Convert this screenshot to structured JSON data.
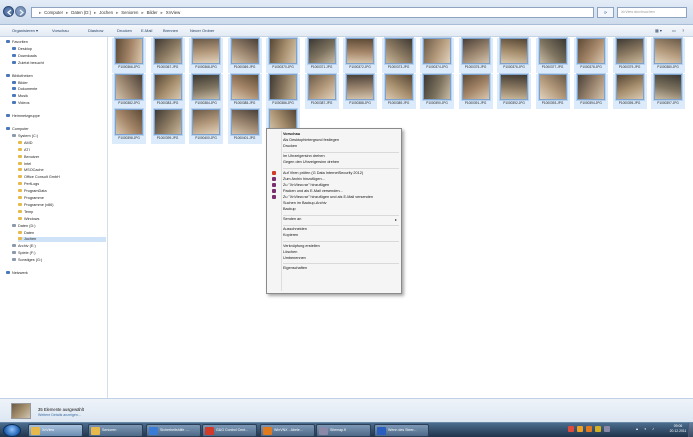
{
  "address_bar": {
    "breadcrumb": [
      "Computer",
      "Daten (D:)",
      "Jochen",
      "Senioren",
      "Bilder",
      "XnView"
    ],
    "search_placeholder": "XnView durchsuchen",
    "refresh_icon": "refresh-icon"
  },
  "toolbar": {
    "organize": "Organisieren ▾",
    "preview": "Vorschau",
    "slideshow": "Diashow",
    "print": "Drucken",
    "email": "E-Mail",
    "burn": "Brennen",
    "new_folder": "Neuer Ordner"
  },
  "nav": {
    "items": [
      {
        "label": "Favoriten",
        "indent": 0,
        "icon": "star-icon"
      },
      {
        "label": "Desktop",
        "indent": 1,
        "icon": "desktop-icon"
      },
      {
        "label": "Downloads",
        "indent": 1,
        "icon": "downloads-icon"
      },
      {
        "label": "Zuletzt besucht",
        "indent": 1,
        "icon": "recent-icon"
      },
      {
        "label": "Bibliotheken",
        "indent": 0,
        "icon": "libraries-icon",
        "gap": true
      },
      {
        "label": "Bilder",
        "indent": 1,
        "icon": "pictures-icon"
      },
      {
        "label": "Dokumente",
        "indent": 1,
        "icon": "documents-icon"
      },
      {
        "label": "Musik",
        "indent": 1,
        "icon": "music-icon"
      },
      {
        "label": "Videos",
        "indent": 1,
        "icon": "videos-icon"
      },
      {
        "label": "Heimnetzgruppe",
        "indent": 0,
        "icon": "homegroup-icon",
        "gap": true
      },
      {
        "label": "Computer",
        "indent": 0,
        "icon": "computer-icon",
        "gap": true
      },
      {
        "label": "System (C:)",
        "indent": 1,
        "icon": "drive-icon"
      },
      {
        "label": "AMD",
        "indent": 2,
        "icon": "folder-icon"
      },
      {
        "label": "ATI",
        "indent": 2,
        "icon": "folder-icon"
      },
      {
        "label": "Benutzer",
        "indent": 2,
        "icon": "folder-icon"
      },
      {
        "label": "Intel",
        "indent": 2,
        "icon": "folder-icon"
      },
      {
        "label": "MSOCache",
        "indent": 2,
        "icon": "folder-icon"
      },
      {
        "label": "Office Consult GmbH",
        "indent": 2,
        "icon": "folder-icon"
      },
      {
        "label": "PerfLogs",
        "indent": 2,
        "icon": "folder-icon"
      },
      {
        "label": "ProgramData",
        "indent": 2,
        "icon": "folder-icon"
      },
      {
        "label": "Programme",
        "indent": 2,
        "icon": "folder-icon"
      },
      {
        "label": "Programme (x86)",
        "indent": 2,
        "icon": "folder-icon"
      },
      {
        "label": "Temp",
        "indent": 2,
        "icon": "folder-icon"
      },
      {
        "label": "Windows",
        "indent": 2,
        "icon": "folder-icon"
      },
      {
        "label": "Daten (D:)",
        "indent": 1,
        "icon": "drive-icon"
      },
      {
        "label": "Daten",
        "indent": 2,
        "icon": "folder-icon"
      },
      {
        "label": "Jochen",
        "indent": 2,
        "icon": "folder-icon",
        "selected": true
      },
      {
        "label": "Archiv (E:)",
        "indent": 1,
        "icon": "drive-icon"
      },
      {
        "label": "Spiele (F:)",
        "indent": 1,
        "icon": "drive-icon"
      },
      {
        "label": "Sonstiges (G:)",
        "indent": 1,
        "icon": "drive-icon"
      },
      {
        "label": "Netzwerk",
        "indent": 0,
        "icon": "network-icon",
        "gap": true
      }
    ]
  },
  "thumbnails": [
    {
      "name": "P1000366.JPG"
    },
    {
      "name": "P1000367.JPG"
    },
    {
      "name": "P1000368.JPG"
    },
    {
      "name": "P1000369.JPG"
    },
    {
      "name": "P1000370.JPG"
    },
    {
      "name": "P1000371.JPG"
    },
    {
      "name": "P1000372.JPG"
    },
    {
      "name": "P1000373.JPG"
    },
    {
      "name": "P1000374.JPG"
    },
    {
      "name": "P1000375.JPG"
    },
    {
      "name": "P1000376.JPG"
    },
    {
      "name": "P1000377.JPG"
    },
    {
      "name": "P1000378.JPG"
    },
    {
      "name": "P1000379.JPG"
    },
    {
      "name": "P1000380.JPG"
    },
    {
      "name": "P1000382.JPG"
    },
    {
      "name": "P1000383.JPG"
    },
    {
      "name": "P1000384.JPG"
    },
    {
      "name": "P1000385.JPG"
    },
    {
      "name": "P1000386.JPG"
    },
    {
      "name": "P1000387.JPG"
    },
    {
      "name": "P1000388.JPG"
    },
    {
      "name": "P1000389.JPG"
    },
    {
      "name": "P1000390.JPG"
    },
    {
      "name": "P1000391.JPG"
    },
    {
      "name": "P1000392.JPG"
    },
    {
      "name": "P1000393.JPG"
    },
    {
      "name": "P1000394.JPG"
    },
    {
      "name": "P1000395.JPG"
    },
    {
      "name": "P1000397.JPG"
    },
    {
      "name": "P1000398.JPG"
    },
    {
      "name": "P1000399.JPG"
    },
    {
      "name": "P1000400.JPG"
    },
    {
      "name": "P1000401.JPG"
    },
    {
      "name": "P1000402.JPG"
    }
  ],
  "context_menu": {
    "items": [
      {
        "label": "Vorschau",
        "bold": true
      },
      {
        "label": "Als Desktophintergrund festlegen"
      },
      {
        "label": "Drucken"
      },
      {
        "sep": true
      },
      {
        "label": "Im Uhrzeigersinn drehen"
      },
      {
        "label": "Gegen den Uhrzeigersinn drehen"
      },
      {
        "sep": true
      },
      {
        "label": "Auf Viren prüfen (G Data InternetSecurity 2012)",
        "icon": "virus-scan-icon",
        "color": "#d23a2a"
      },
      {
        "label": "Zum Archiv hinzufügen...",
        "icon": "winrar-icon",
        "color": "#7a2f6e"
      },
      {
        "label": "Zu \"XnView.rar\" hinzufügen",
        "icon": "winrar-icon",
        "color": "#7a2f6e"
      },
      {
        "label": "Packen und als E-Mail versenden...",
        "icon": "winrar-icon",
        "color": "#7a2f6e"
      },
      {
        "label": "Zu \"XnView.rar\" hinzufügen und als E-Mail versenden",
        "icon": "winrar-icon",
        "color": "#7a2f6e"
      },
      {
        "label": "Suchen im Backup-Archiv"
      },
      {
        "label": "Backup"
      },
      {
        "sep": true
      },
      {
        "label": "Senden an",
        "arrow": "▸"
      },
      {
        "sep": true
      },
      {
        "label": "Ausschneiden"
      },
      {
        "label": "Kopieren"
      },
      {
        "sep": true
      },
      {
        "label": "Verknüpfung erstellen"
      },
      {
        "label": "Löschen"
      },
      {
        "label": "Umbenennen"
      },
      {
        "sep": true
      },
      {
        "label": "Eigenschaften"
      }
    ]
  },
  "details_pane": {
    "selected_text": "35 Elemente ausgewählt",
    "more_link": "Weitere Details anzeigen..."
  },
  "taskbar": {
    "buttons": [
      {
        "label": "XnView",
        "color": "#e7b94a",
        "active": true
      },
      {
        "label": "Senioren",
        "color": "#e7b94a"
      },
      {
        "label": "Sicherheitshilfe -...",
        "color": "#3a7bd5"
      },
      {
        "label": "G&G Control Cent...",
        "color": "#d23a2a"
      },
      {
        "label": "WinVNX - Abele...",
        "color": "#e07a1f"
      },
      {
        "label": "Sitemap.fl",
        "color": "#8a8aa8"
      },
      {
        "label": "Wenn des Steer...",
        "color": "#2a5fbf"
      }
    ],
    "clock_time": "09:06",
    "clock_date": "20.12.2011",
    "tray_colors": [
      "#e04a3a",
      "#f0a020",
      "#e07a1f",
      "#d4b020",
      "#8a8aa8"
    ]
  },
  "colors": {
    "accent": "#3a6ba5",
    "selection": "#cfe3f8"
  }
}
